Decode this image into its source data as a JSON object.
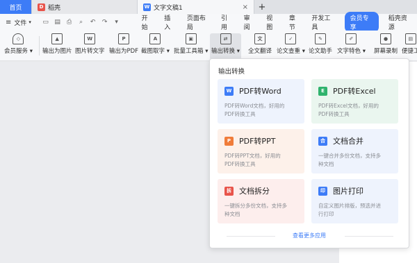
{
  "tabbar": {
    "home": "首页",
    "shell": "稻壳",
    "doc": "文字文稿1",
    "doc_close": "×",
    "new_tab": "+"
  },
  "menurow": {
    "file": "文件",
    "file_caret": "▾",
    "menus": [
      "开始",
      "插入",
      "页面布局",
      "引用",
      "审阅",
      "视图",
      "章节",
      "开发工具",
      "会员专享",
      "稻壳资源"
    ]
  },
  "ribbon": {
    "tools": [
      {
        "label": "会员服务 ▾"
      },
      {
        "label": "输出为图片"
      },
      {
        "label": "图片转文字"
      },
      {
        "label": "输出为PDF"
      },
      {
        "label": "截图取字 ▾"
      },
      {
        "label": "批量工具箱 ▾"
      },
      {
        "label": "输出转换 ▾"
      },
      {
        "label": "全文翻译"
      },
      {
        "label": "论文查重 ▾"
      },
      {
        "label": "论文助手"
      },
      {
        "label": "文字特色 ▾"
      },
      {
        "label": "屏幕录制"
      },
      {
        "label": "便捷工"
      }
    ]
  },
  "panel": {
    "title": "输出转换",
    "more": "查看更多应用",
    "cards": [
      {
        "title": "PDF转Word",
        "desc": "PDF转Word文档，好用的PDF转换工具",
        "color": "#3d7cf7",
        "icon": "W"
      },
      {
        "title": "PDF转Excel",
        "desc": "PDF转Excel文档，好用的PDF转换工具",
        "color": "#2fb36d",
        "icon": "E"
      },
      {
        "title": "PDF转PPT",
        "desc": "PDF转PPT文档，好用的PDF转换工具",
        "color": "#f07c3a",
        "icon": "P"
      },
      {
        "title": "文档合并",
        "desc": "一键合并多份文档，支持多种文档",
        "color": "#3d7cf7",
        "icon": "合"
      },
      {
        "title": "文档拆分",
        "desc": "一键拆分多份文档，支持多种文档",
        "color": "#e8534a",
        "icon": "拆"
      },
      {
        "title": "图片打印",
        "desc": "自定义图片排版，预选并进行打印",
        "color": "#3d7cf7",
        "icon": "印"
      }
    ]
  },
  "colors": {
    "accent": "#3d7cf7",
    "card_blue_bg": "#eef3fd",
    "card_green_bg": "#eaf6ef",
    "card_orange_bg": "#fdf1ea",
    "card_red_bg": "#fdeeed"
  }
}
